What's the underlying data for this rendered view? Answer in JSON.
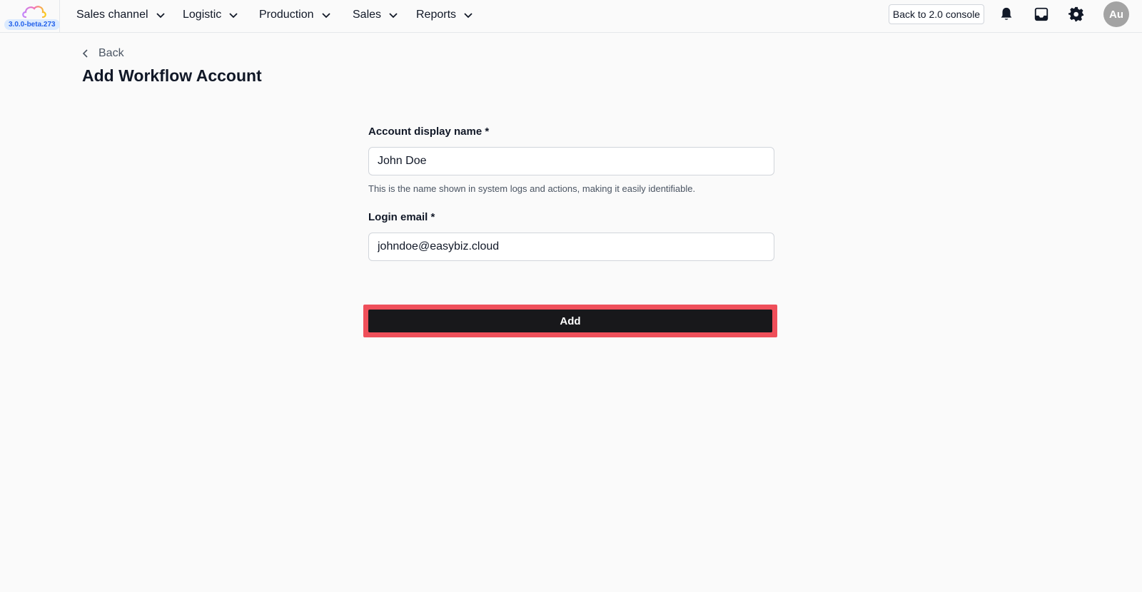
{
  "app": {
    "version": "3.0.0-beta.273",
    "logo_icon": "cloud-logo-icon"
  },
  "nav": {
    "items": [
      {
        "label": "Sales channel",
        "icon": "chevron-down-icon"
      },
      {
        "label": "Logistic",
        "icon": "chevron-down-icon"
      },
      {
        "label": "Production",
        "icon": "chevron-down-icon"
      },
      {
        "label": "Sales",
        "icon": "chevron-down-icon"
      },
      {
        "label": "Reports",
        "icon": "chevron-down-icon"
      }
    ],
    "console_button": "Back to 2.0 console",
    "icons": [
      "bell-icon",
      "inbox-icon",
      "gear-icon"
    ],
    "avatar_initials": "Au"
  },
  "page": {
    "back_label": "Back",
    "title": "Add Workflow Account"
  },
  "form": {
    "display_name": {
      "label": "Account display name *",
      "value": "John Doe",
      "help": "This is the name shown in system logs and actions, making it easily identifiable."
    },
    "login_email": {
      "label": "Login email *",
      "value": "johndoe@easybiz.cloud"
    },
    "submit_label": "Add"
  },
  "colors": {
    "accent_highlight": "#ef4f5a",
    "button_bg": "#18181b",
    "version_badge_bg": "#dbeafe",
    "version_badge_text": "#2563eb"
  }
}
